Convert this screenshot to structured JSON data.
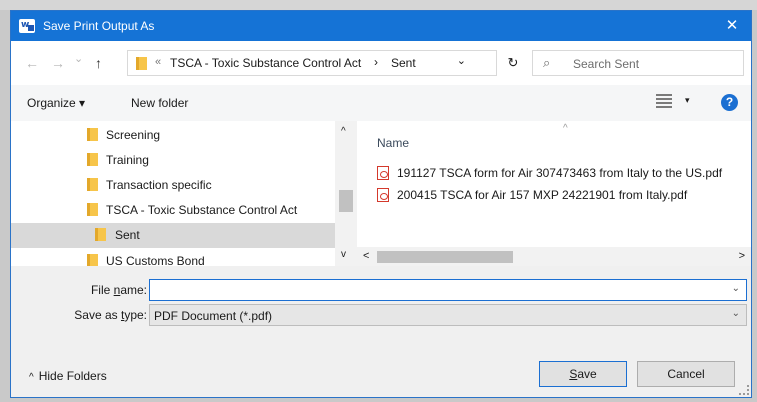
{
  "window": {
    "title": "Save Print Output As",
    "app_icon_letter": "w",
    "close_glyph": "✕"
  },
  "nav": {
    "back_glyph": "←",
    "forward_glyph": "→",
    "recent_glyph": "⌄",
    "up_glyph": "↑",
    "address": {
      "overflow_glyph": "«",
      "segments": [
        "TSCA - Toxic Substance Control Act",
        "Sent"
      ],
      "separator_glyph": "›",
      "dropdown_glyph": "⌄"
    },
    "refresh_glyph": "↻",
    "search_placeholder": "Search Sent",
    "search_glyph": "⌕"
  },
  "toolbar": {
    "organize_label": "Organize ▾",
    "new_folder_label": "New folder",
    "view_dropdown_glyph": "▾",
    "help_glyph": "?"
  },
  "tree": {
    "items": [
      {
        "label": "Screening"
      },
      {
        "label": "Training"
      },
      {
        "label": "Transaction specific"
      },
      {
        "label": "TSCA - Toxic Substance Control Act"
      },
      {
        "label": "Sent",
        "selected": true
      },
      {
        "label": "US Customs Bond"
      }
    ],
    "scroll_up_glyph": "^",
    "scroll_down_glyph": "v"
  },
  "files": {
    "column_name": "Name",
    "sort_glyph": "^",
    "items": [
      {
        "name": "191127 TSCA form for Air 307473463 from Italy to the US.pdf"
      },
      {
        "name": "200415 TSCA for Air 157 MXP 24221901 from Italy.pdf"
      }
    ],
    "scroll_left_glyph": "<",
    "scroll_right_glyph": ">"
  },
  "form": {
    "file_name_label_pre": "File ",
    "file_name_label_ul": "n",
    "file_name_label_post": "ame:",
    "file_name_value": "",
    "save_type_label_pre": "Save as ",
    "save_type_label_ul": "t",
    "save_type_label_post": "ype:",
    "save_type_value": "PDF Document (*.pdf)",
    "dropdown_glyph": "⌄"
  },
  "footer": {
    "hide_folders_glyph": "^",
    "hide_folders_label": "Hide Folders",
    "save_label_ul": "S",
    "save_label_post": "ave",
    "cancel_label": "Cancel"
  }
}
